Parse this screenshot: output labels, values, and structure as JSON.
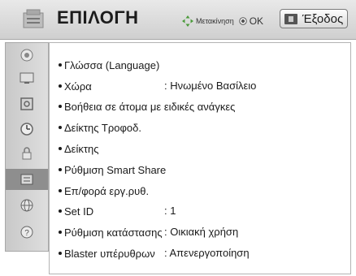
{
  "header": {
    "title": "ΕΠΙΛΟΓΗ",
    "nav_hint": "Μετακίνηση",
    "nav_ok": "OK",
    "exit_label": "Έξοδος"
  },
  "sidebar": {
    "items": [
      {
        "icon": "picture-icon"
      },
      {
        "icon": "monitor-icon"
      },
      {
        "icon": "channel-icon"
      },
      {
        "icon": "clock-icon"
      },
      {
        "icon": "lock-icon"
      },
      {
        "icon": "option-icon",
        "active": true
      },
      {
        "icon": "network-icon"
      },
      {
        "icon": "support-icon"
      }
    ]
  },
  "menu": {
    "items": [
      {
        "label": "Γλώσσα (Language)",
        "value": ""
      },
      {
        "label": "Χώρα",
        "value": ": Ηνωμένο Βασίλειο"
      },
      {
        "label": "Βοήθεια σε άτομα με ειδικές ανάγκες",
        "value": ""
      },
      {
        "label": "Δείκτης Τροφοδ.",
        "value": ""
      },
      {
        "label": "Δείκτης",
        "value": ""
      },
      {
        "label": "Ρύθμιση Smart Share",
        "value": ""
      },
      {
        "label": "Επ/φορά εργ.ρυθ.",
        "value": ""
      },
      {
        "label": "Set ID",
        "value": ": 1"
      },
      {
        "label": "Ρύθμιση κατάστασης",
        "value": ": Οικιακή χρήση"
      },
      {
        "label": "Blaster υπέρυθρων",
        "value": ": Απενεργοποίηση"
      }
    ]
  },
  "colors": {
    "header_bg": "#d6d6d6",
    "sidebar_bg": "#d2d2d2",
    "sidebar_active": "#8e8e8e",
    "text": "#1a1a1a"
  }
}
